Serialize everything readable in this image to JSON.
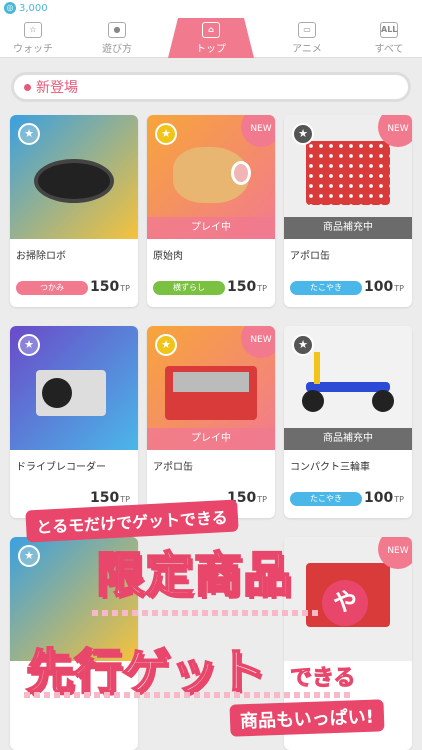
{
  "header": {
    "coins": "3,000"
  },
  "tabs": [
    {
      "label": "ウォッチ",
      "icon": "star-icon"
    },
    {
      "label": "遊び方",
      "icon": "robot-icon"
    },
    {
      "label": "トップ",
      "icon": "home-icon",
      "active": true
    },
    {
      "label": "アニメ",
      "icon": "tv-icon"
    },
    {
      "label": "すべて",
      "icon": "all-icon",
      "badge": "ALL"
    }
  ],
  "section": {
    "title": "新登場"
  },
  "cards": [
    {
      "name": "お掃除ロボ",
      "tag": "つかみ",
      "tag_color": "#f27a8f",
      "price": "150",
      "unit": "TP",
      "new": false,
      "status": "",
      "bg": "#3aa0e0"
    },
    {
      "name": "原始肉",
      "tag": "横ずらし",
      "tag_color": "#7ac142",
      "price": "150",
      "unit": "TP",
      "new": true,
      "new_label": "NEW",
      "status": "プレイ中",
      "bg": "#f7a53a"
    },
    {
      "name": "アポロ缶",
      "tag": "たこやき",
      "tag_color": "#4ab7e8",
      "price": "100",
      "unit": "TP",
      "new": true,
      "new_label": "NEW",
      "status": "商品補充中",
      "bg": "#d93b3b"
    },
    {
      "name": "ドライブレコーダー",
      "tag": "",
      "tag_color": "#f27a8f",
      "price": "150",
      "unit": "TP",
      "new": false,
      "status": "",
      "bg": "#7a4fc9"
    },
    {
      "name": "アポロ缶",
      "tag": "",
      "tag_color": "#7ac142",
      "price": "150",
      "unit": "TP",
      "new": true,
      "new_label": "NEW",
      "status": "プレイ中",
      "bg": "#f7a53a"
    },
    {
      "name": "コンパクト三輪車",
      "tag": "たこやき",
      "tag_color": "#4ab7e8",
      "price": "100",
      "unit": "TP",
      "new": false,
      "status": "商品補充中",
      "bg": "#f2f2f2"
    }
  ],
  "banner": {
    "line1": "とるモだけでゲットできる",
    "big1": "限定商品",
    "ya": "や",
    "big2": "先行ゲット",
    "dekiru": "できる",
    "line3": "商品もいっぱい!"
  }
}
